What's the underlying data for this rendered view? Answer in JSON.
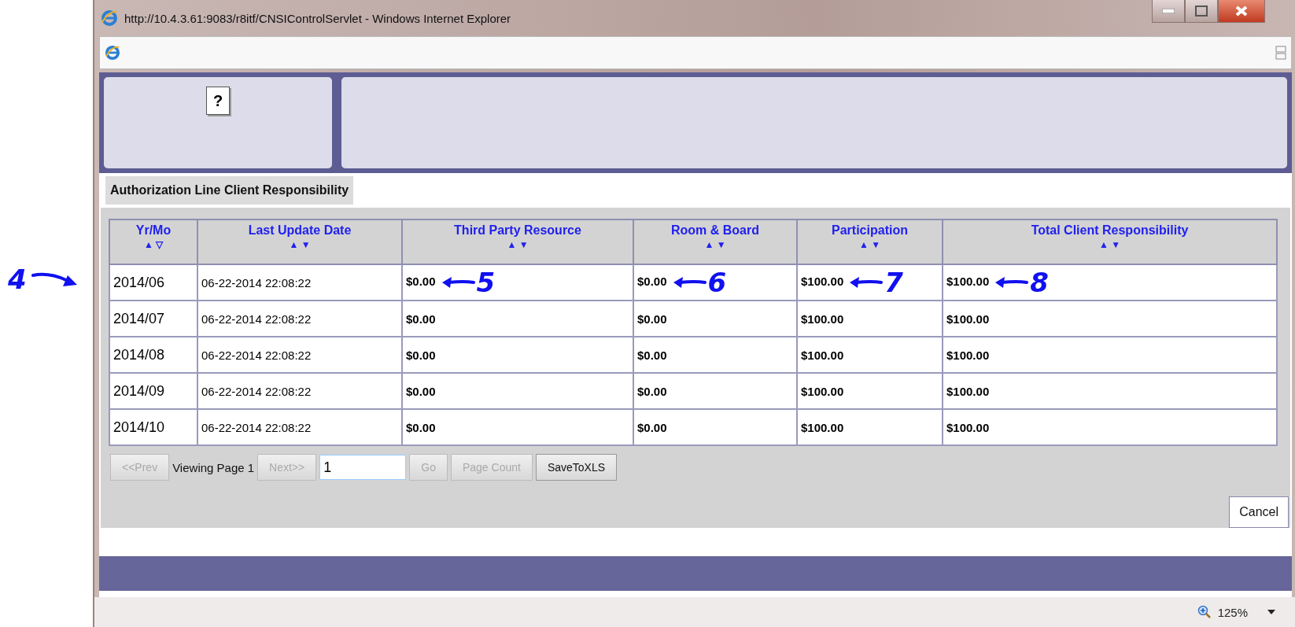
{
  "window": {
    "title": "http://10.4.3.61:9083/r8itf/CNSIControlServlet - Windows Internet Explorer"
  },
  "help": {
    "label": "?"
  },
  "section_title": "Authorization Line Client Responsibility",
  "table": {
    "columns": [
      {
        "label": "Yr/Mo",
        "sort_up": "▲",
        "sort_down": "▽"
      },
      {
        "label": "Last Update Date",
        "sort_up": "▲",
        "sort_down": "▼"
      },
      {
        "label": "Third Party Resource",
        "sort_up": "▲",
        "sort_down": "▼"
      },
      {
        "label": "Room & Board",
        "sort_up": "▲",
        "sort_down": "▼"
      },
      {
        "label": "Participation",
        "sort_up": "▲",
        "sort_down": "▼"
      },
      {
        "label": "Total Client Responsibility",
        "sort_up": "▲",
        "sort_down": "▼"
      }
    ],
    "rows": [
      {
        "cells": [
          {
            "text": "2014/06",
            "note": "4"
          },
          {
            "text": "06-22-2014 22:08:22"
          },
          {
            "text": "$0.00",
            "note": "5"
          },
          {
            "text": "$0.00",
            "note": "6"
          },
          {
            "text": "$100.00",
            "note": "7"
          },
          {
            "text": "$100.00",
            "note": "8"
          }
        ]
      },
      {
        "cells": [
          "2014/07",
          "06-22-2014 22:08:22",
          "$0.00",
          "$0.00",
          "$100.00",
          "$100.00"
        ]
      },
      {
        "cells": [
          "2014/08",
          "06-22-2014 22:08:22",
          "$0.00",
          "$0.00",
          "$100.00",
          "$100.00"
        ]
      },
      {
        "cells": [
          "2014/09",
          "06-22-2014 22:08:22",
          "$0.00",
          "$0.00",
          "$100.00",
          "$100.00"
        ]
      },
      {
        "cells": [
          "2014/10",
          "06-22-2014 22:08:22",
          "$0.00",
          "$0.00",
          "$100.00",
          "$100.00"
        ]
      }
    ]
  },
  "pager": {
    "prev": {
      "label": "<<Prev",
      "disabled": true
    },
    "status": "Viewing Page 1",
    "next": {
      "label": "Next>>",
      "disabled": true
    },
    "page_input": "1",
    "go": {
      "label": "Go",
      "disabled": true
    },
    "page_count": {
      "label": "Page Count",
      "disabled": true
    },
    "save": {
      "label": "SaveToXLS",
      "disabled": false
    }
  },
  "cancel": "Cancel",
  "status_bar": {
    "zoom": "125%"
  }
}
